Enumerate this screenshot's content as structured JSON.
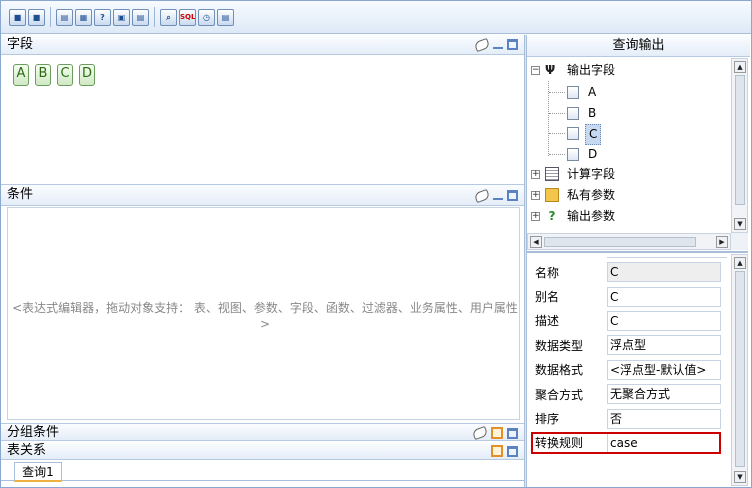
{
  "toolbar": {
    "buttons": [
      {
        "name": "save-icon",
        "glyph": "■"
      },
      {
        "name": "save-as-icon",
        "glyph": "■"
      },
      {
        "name": "window-icon",
        "glyph": "▤"
      },
      {
        "name": "table-icon",
        "glyph": "▦"
      },
      {
        "name": "help-icon",
        "glyph": "?"
      },
      {
        "name": "chart-icon",
        "glyph": "▣"
      },
      {
        "name": "settings-icon",
        "glyph": "▤"
      },
      {
        "name": "search-icon",
        "glyph": "⌕"
      },
      {
        "name": "sql-icon",
        "glyph": "SQL"
      },
      {
        "name": "clock-icon",
        "glyph": "◷"
      },
      {
        "name": "export-icon",
        "glyph": "▤"
      }
    ]
  },
  "fields_panel": {
    "title": "字段",
    "fields": [
      "A",
      "B",
      "C",
      "D"
    ]
  },
  "conditions_panel": {
    "title": "条件",
    "hint": "<表达式编辑器，拖动对象支持：  表、视图、参数、字段、函数、过滤器、业务属性、用户属性>"
  },
  "group_panel": {
    "title": "分组条件"
  },
  "relation_panel": {
    "title": "表关系",
    "tabs": [
      "查询1"
    ]
  },
  "output_panel": {
    "title": "查询输出",
    "tree": {
      "output_fields": {
        "label": "输出字段",
        "children": [
          "A",
          "B",
          "C",
          "D"
        ],
        "selected": "C"
      },
      "others": [
        {
          "label": "计算字段",
          "icon": "calc-fields-icon"
        },
        {
          "label": "私有参数",
          "icon": "private-params-icon"
        },
        {
          "label": "输出参数",
          "icon": "output-params-icon"
        }
      ]
    },
    "properties": [
      {
        "label": "名称",
        "value": "C"
      },
      {
        "label": "别名",
        "value": "C"
      },
      {
        "label": "描述",
        "value": "C"
      },
      {
        "label": "数据类型",
        "value": "浮点型"
      },
      {
        "label": "数据格式",
        "value": "<浮点型-默认值>"
      },
      {
        "label": "聚合方式",
        "value": "无聚合方式"
      },
      {
        "label": "排序",
        "value": "否"
      },
      {
        "label": "转换规则",
        "value": "case"
      }
    ]
  },
  "colors": {
    "border": "#8aa8cf",
    "highlight": "#cc0000",
    "selected": "#c6d9f1"
  }
}
